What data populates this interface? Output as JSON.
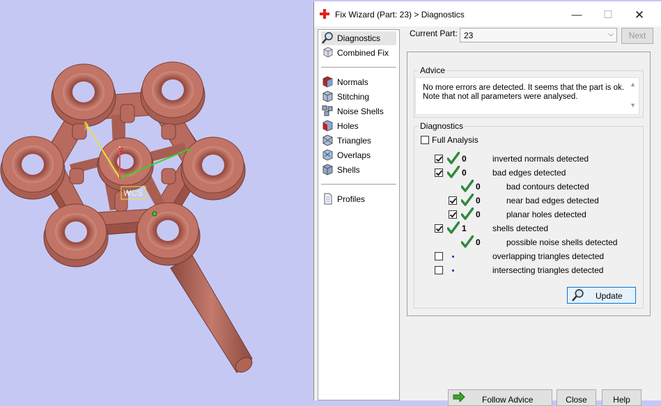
{
  "window": {
    "title": "Fix Wizard (Part: 23) > Diagnostics"
  },
  "viewport": {
    "wcs_label": "WCS",
    "axis_z": "z",
    "axis_y": "y",
    "axis_x": "x",
    "colors": {
      "background": "#c6c8f4",
      "part": "#b86a5e"
    }
  },
  "sidebar": {
    "groups": [
      [
        {
          "label": "Diagnostics",
          "icon": "magnifier-icon",
          "selected": true
        },
        {
          "label": "Combined Fix",
          "icon": "cube-icon"
        }
      ],
      [
        {
          "label": "Normals",
          "icon": "normals-icon"
        },
        {
          "label": "Stitching",
          "icon": "stitching-icon"
        },
        {
          "label": "Noise Shells",
          "icon": "noise-shells-icon"
        },
        {
          "label": "Holes",
          "icon": "holes-icon"
        },
        {
          "label": "Triangles",
          "icon": "triangles-icon"
        },
        {
          "label": "Overlaps",
          "icon": "overlaps-icon"
        },
        {
          "label": "Shells",
          "icon": "shells-icon"
        }
      ],
      [
        {
          "label": "Profiles",
          "icon": "document-icon"
        }
      ]
    ]
  },
  "current_part": {
    "label": "Current Part:",
    "value": "23",
    "next_label": "Next"
  },
  "advice": {
    "legend": "Advice",
    "line1": "No more errors are detected. It seems that the part is ok.",
    "line2": "Note that not all parameters were analysed."
  },
  "diagnostics": {
    "legend": "Diagnostics",
    "full_analysis_label": "Full Analysis",
    "full_analysis_checked": false,
    "rows": [
      {
        "checked": true,
        "status": "ok",
        "count": "0",
        "text": "inverted normals detected",
        "indent": 0
      },
      {
        "checked": true,
        "status": "ok",
        "count": "0",
        "text": "bad edges detected",
        "indent": 0
      },
      {
        "checked": null,
        "status": "ok",
        "count": "0",
        "text": "bad contours detected",
        "indent": 1
      },
      {
        "checked": true,
        "status": "ok",
        "count": "0",
        "text": "near bad edges detected",
        "indent": 1
      },
      {
        "checked": true,
        "status": "ok",
        "count": "0",
        "text": "planar holes detected",
        "indent": 1
      },
      {
        "checked": true,
        "status": "ok",
        "count": "1",
        "text": "shells detected",
        "indent": 0
      },
      {
        "checked": null,
        "status": "ok",
        "count": "0",
        "text": "possible noise shells detected",
        "indent": 1
      },
      {
        "checked": false,
        "status": "none",
        "count": "",
        "text": "overlapping triangles detected",
        "indent": 0
      },
      {
        "checked": false,
        "status": "none",
        "count": "",
        "text": "intersecting triangles detected",
        "indent": 0
      }
    ],
    "update_label": "Update"
  },
  "footer": {
    "follow_advice": "Follow Advice",
    "close": "Close",
    "help": "Help"
  }
}
